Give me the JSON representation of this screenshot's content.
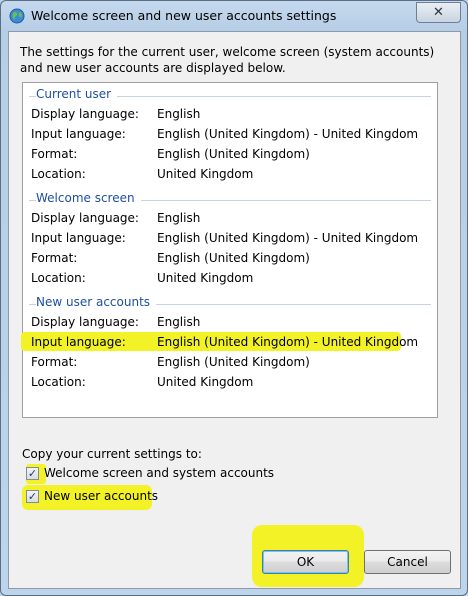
{
  "window": {
    "title": "Welcome screen and new user accounts settings",
    "close_glyph": "✕"
  },
  "description": "The settings for the current user, welcome screen (system accounts) and new user accounts are displayed below.",
  "labels": {
    "display_language": "Display language:",
    "input_language": "Input language:",
    "format": "Format:",
    "location": "Location:"
  },
  "sections": [
    {
      "heading": "Current user",
      "display_language": "English",
      "input_language": "English (United Kingdom) - United Kingdom",
      "format": "English (United Kingdom)",
      "location": "United Kingdom"
    },
    {
      "heading": "Welcome screen",
      "display_language": "English",
      "input_language": "English (United Kingdom) - United Kingdom",
      "format": "English (United Kingdom)",
      "location": "United Kingdom"
    },
    {
      "heading": "New user accounts",
      "display_language": "English",
      "input_language": "English (United Kingdom) - United Kingdom",
      "format": "English (United Kingdom)",
      "location": "United Kingdom"
    }
  ],
  "copy": {
    "label": "Copy your current settings to:",
    "options": [
      {
        "label": "Welcome screen and system accounts",
        "checked": true
      },
      {
        "label": "New user accounts",
        "checked": true
      }
    ],
    "check_glyph": "✓"
  },
  "buttons": {
    "ok": "OK",
    "cancel": "Cancel"
  },
  "colors": {
    "highlight": "#f2f227",
    "section_heading": "#1e4fa0"
  }
}
